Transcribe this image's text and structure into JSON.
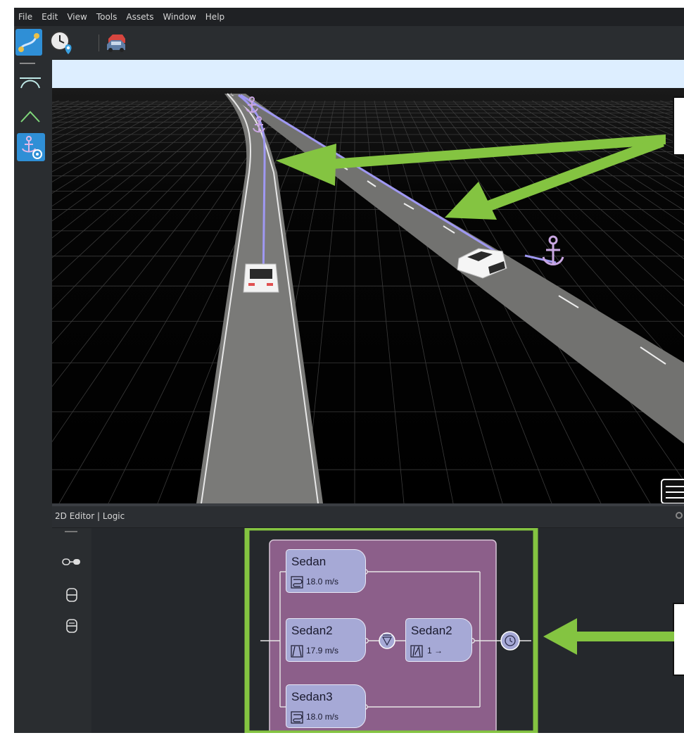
{
  "menu": {
    "items": [
      "File",
      "Edit",
      "View",
      "Tools",
      "Assets",
      "Window",
      "Help"
    ]
  },
  "toolbar": {
    "buttons": [
      {
        "icon": "route-icon",
        "selected": true
      },
      {
        "icon": "clock-pin-icon",
        "selected": false
      },
      {
        "icon": "cars-icon",
        "selected": false
      }
    ]
  },
  "left_tools": {
    "icons": [
      "curve-road-icon",
      "peak-road-icon",
      "anchor-camera-icon"
    ]
  },
  "panel": {
    "title": "2D Editor | Logic"
  },
  "logic": {
    "nodes": [
      {
        "name": "Sedan",
        "value": "18.0 m/s",
        "icon": "loop-path-icon"
      },
      {
        "name": "Sedan2",
        "value": "17.9 m/s",
        "icon": "road-perspective-icon"
      },
      {
        "name": "Sedan2",
        "value": "1 →",
        "icon": "lane-change-icon"
      },
      {
        "name": "Sedan3",
        "value": "18.0 m/s",
        "icon": "loop-path-icon"
      }
    ]
  },
  "colors": {
    "accent_green": "#84c441",
    "selection_blue": "#2f8fd6",
    "group_purple": "#8c5f8a",
    "node_lavender": "#a6a9d6",
    "route_lavender": "#9f98f2",
    "road_gray": "#7a7a78"
  }
}
